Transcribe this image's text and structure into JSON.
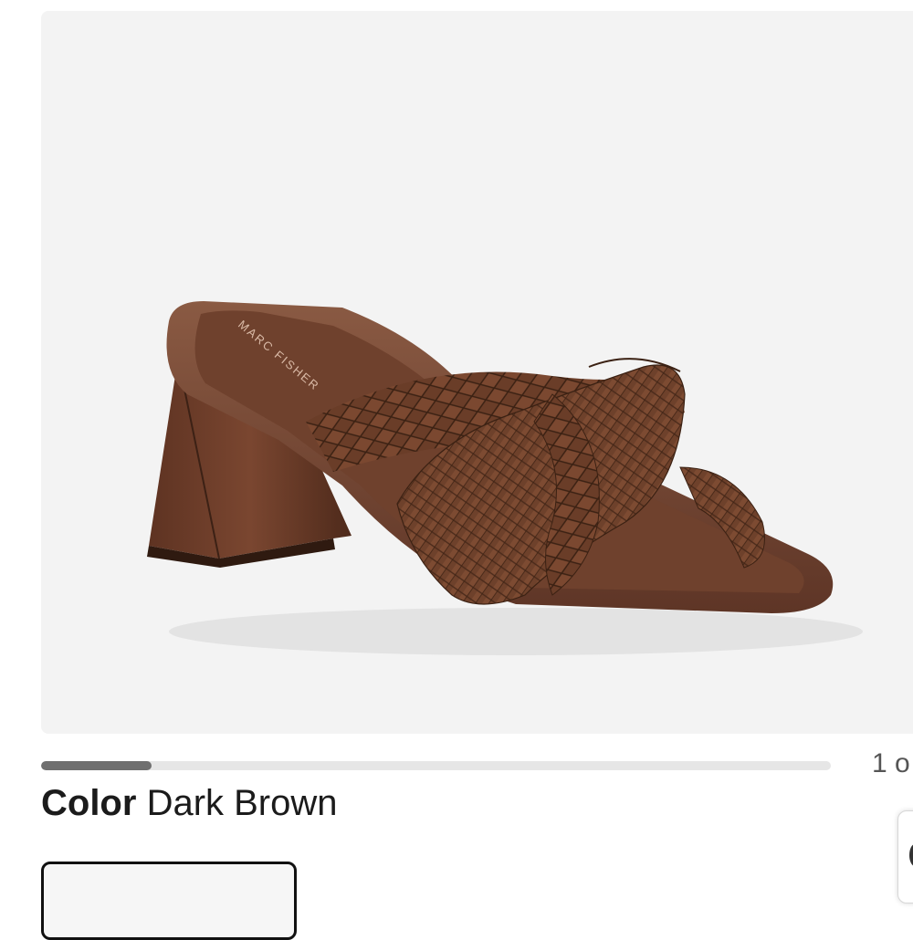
{
  "product": {
    "image_alt": "Dark brown woven leather block-heel slide sandal",
    "brand_imprint": "MARC FISHER"
  },
  "gallery": {
    "counter_text": "1 o",
    "progress_fraction": 0.14
  },
  "color": {
    "label": "Color",
    "value": "Dark Brown"
  },
  "colors": {
    "leather": "#6b3f2a",
    "progress_fill": "#6f6f6f",
    "card_bg": "#f3f3f3"
  }
}
